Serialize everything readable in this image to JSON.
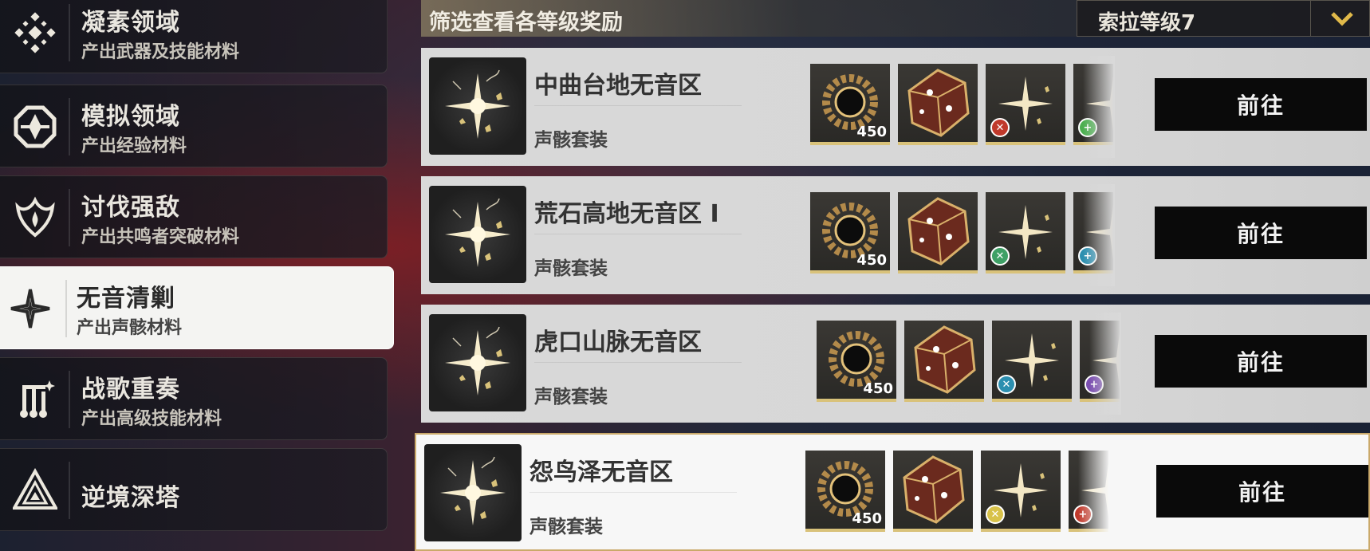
{
  "sidebar": {
    "items": [
      {
        "title": "凝素领域",
        "subtitle": "产出武器及技能材料",
        "icon": "crystal-cross-icon"
      },
      {
        "title": "模拟领域",
        "subtitle": "产出经验材料",
        "icon": "octagon-emblem-icon"
      },
      {
        "title": "讨伐强敌",
        "subtitle": "产出共鸣者突破材料",
        "icon": "flame-crest-icon"
      },
      {
        "title": "无音清剿",
        "subtitle": "产出声骸材料",
        "icon": "sparkle-star-icon"
      },
      {
        "title": "战歌重奏",
        "subtitle": "产出高级技能材料",
        "icon": "music-glyph-icon"
      },
      {
        "title": "逆境深塔",
        "subtitle": "",
        "icon": "tower-triangle-icon"
      }
    ],
    "active_index": 3
  },
  "header": {
    "title": "筛选查看各等级奖励",
    "level_select": "索拉等级7"
  },
  "cards": [
    {
      "title": "中曲台地无音区",
      "subtitle": "声骸套装",
      "reward_qty": "450",
      "button": "前往",
      "badges": [
        "#c0392b",
        "#4caf50"
      ]
    },
    {
      "title": "荒石高地无音区 I",
      "subtitle": "声骸套装",
      "reward_qty": "450",
      "button": "前往",
      "badges": [
        "#3fa066",
        "#2c8fb0"
      ]
    },
    {
      "title": "虎口山脉无音区",
      "subtitle": "声骸套装",
      "reward_qty": "450",
      "button": "前往",
      "badges": [
        "#2c8fb0",
        "#7b4fb0"
      ]
    },
    {
      "title": "怨鸟泽无音区",
      "subtitle": "声骸套装",
      "reward_qty": "450",
      "button": "前往",
      "badges": [
        "#d8c24a",
        "#c0392b"
      ]
    }
  ],
  "colors": {
    "accent_gold": "#d9c27a",
    "button_bg": "#0a0a0a"
  }
}
